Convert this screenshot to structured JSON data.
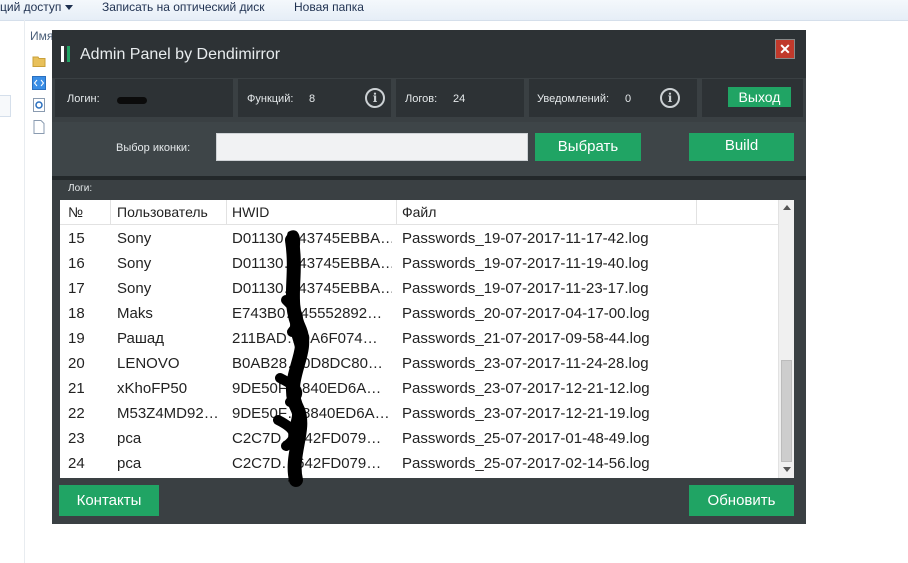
{
  "explorer": {
    "toolbar": {
      "share": "ций доступ",
      "burn": "Записать на оптический диск",
      "new_folder": "Новая папка"
    },
    "column_name": "Имя"
  },
  "window": {
    "title": "Admin Panel by Dendimirror",
    "close": "✕",
    "logo_colors": [
      "#ffffff",
      "#20a464"
    ]
  },
  "stats": {
    "login_label": "Логин:",
    "login_value": "",
    "functions_label": "Функций:",
    "functions_value": "8",
    "logs_label": "Логов:",
    "logs_value": "24",
    "notifications_label": "Уведомлений:",
    "notifications_value": "0",
    "logout_button": "Выход"
  },
  "builder": {
    "icon_label": "Выбор иконки:",
    "icon_value": "",
    "choose_button": "Выбрать",
    "build_button": "Build"
  },
  "logs": {
    "label": "Логи:",
    "columns": [
      "№",
      "Пользователь",
      "HWID",
      "Файл"
    ],
    "rows": [
      [
        "15",
        "Sony",
        "D01130…43745EBBA…",
        "Passwords_19-07-2017-11-17-42.log"
      ],
      [
        "16",
        "Sony",
        "D01130…43745EBBA…",
        "Passwords_19-07-2017-11-19-40.log"
      ],
      [
        "17",
        "Sony",
        "D01130…43745EBBA…",
        "Passwords_19-07-2017-11-23-17.log"
      ],
      [
        "18",
        "Maks",
        "E743B0…45552892…",
        "Passwords_20-07-2017-04-17-00.log"
      ],
      [
        "19",
        "Рашад",
        "211BAD…9A6F074…",
        "Passwords_21-07-2017-09-58-44.log"
      ],
      [
        "20",
        "LENOVO",
        "B0AB28…0D8DC80…",
        "Passwords_23-07-2017-11-24-28.log"
      ],
      [
        "21",
        "xKhoFP50",
        "9DE50F…840ED6A…",
        "Passwords_23-07-2017-12-21-12.log"
      ],
      [
        "22",
        "M53Z4MD92…",
        "9DE50F…8840ED6A…",
        "Passwords_23-07-2017-12-21-19.log"
      ],
      [
        "23",
        "pca",
        "C2C7D…642FD079…",
        "Passwords_25-07-2017-01-48-49.log"
      ],
      [
        "24",
        "pca",
        "C2C7D…642FD079…",
        "Passwords_25-07-2017-02-14-56.log"
      ]
    ]
  },
  "footer": {
    "contacts_button": "Контакты",
    "refresh_button": "Обновить"
  },
  "colors": {
    "accent": "#20a464",
    "panel": "#2d3235",
    "close": "#c0392b"
  }
}
